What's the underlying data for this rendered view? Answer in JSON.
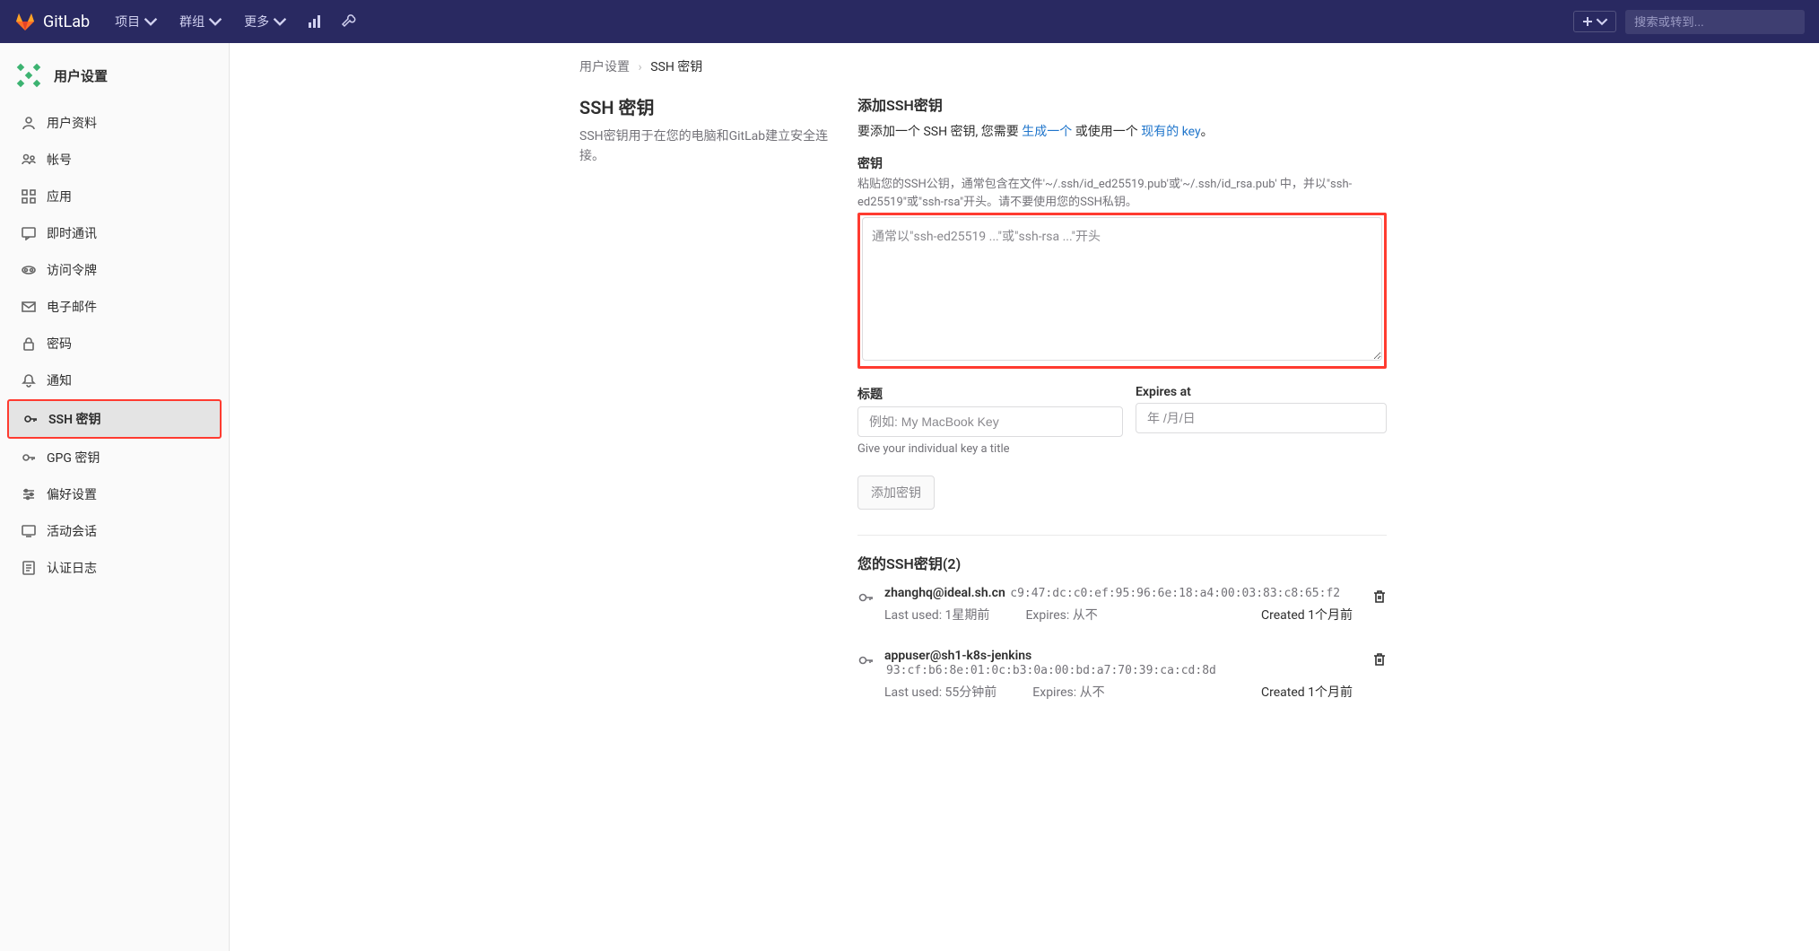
{
  "navbar": {
    "brand": "GitLab",
    "items": [
      {
        "label": "项目"
      },
      {
        "label": "群组"
      },
      {
        "label": "更多"
      }
    ],
    "search_placeholder": "搜索或转到..."
  },
  "sidebar": {
    "title": "用户设置",
    "items": [
      {
        "label": "用户资料",
        "icon": "user"
      },
      {
        "label": "帐号",
        "icon": "account"
      },
      {
        "label": "应用",
        "icon": "apps"
      },
      {
        "label": "即时通讯",
        "icon": "chat"
      },
      {
        "label": "访问令牌",
        "icon": "token"
      },
      {
        "label": "电子邮件",
        "icon": "mail"
      },
      {
        "label": "密码",
        "icon": "lock"
      },
      {
        "label": "通知",
        "icon": "bell"
      },
      {
        "label": "SSH 密钥",
        "icon": "key",
        "active": true
      },
      {
        "label": "GPG 密钥",
        "icon": "key"
      },
      {
        "label": "偏好设置",
        "icon": "pref"
      },
      {
        "label": "活动会话",
        "icon": "session"
      },
      {
        "label": "认证日志",
        "icon": "log"
      }
    ]
  },
  "breadcrumb": {
    "parent": "用户设置",
    "current": "SSH 密钥"
  },
  "left": {
    "title": "SSH 密钥",
    "desc": "SSH密钥用于在您的电脑和GitLab建立安全连接。"
  },
  "right": {
    "add_title": "添加SSH密钥",
    "intro_pre": "要添加一个 SSH 密钥, 您需要 ",
    "intro_link1": "生成一个",
    "intro_mid": " 或使用一个 ",
    "intro_link2": "现有的 key",
    "intro_end": "。",
    "key_label": "密钥",
    "key_help": "粘贴您的SSH公钥，通常包含在文件'~/.ssh/id_ed25519.pub'或'~/.ssh/id_rsa.pub' 中，并以\"ssh-ed25519\"或\"ssh-rsa\"开头。请不要使用您的SSH私钥。",
    "key_placeholder": "通常以\"ssh-ed25519 ...\"或\"ssh-rsa ...\"开头",
    "title_label": "标题",
    "title_placeholder": "例如: My MacBook Key",
    "title_help": "Give your individual key a title",
    "expires_label": "Expires at",
    "expires_placeholder": "年 /月/日",
    "submit": "添加密钥"
  },
  "keys_section": {
    "title": "您的SSH密钥(2)",
    "keys": [
      {
        "name": "zhanghq@ideal.sh.cn",
        "fp": "c9:47:dc:c0:ef:95:96:6e:18:a4:00:03:83:c8:65:f2",
        "last_used": "Last used: 1星期前",
        "expires": "Expires: 从不",
        "created": "Created 1个月前"
      },
      {
        "name": "appuser@sh1-k8s-jenkins",
        "fp": "93:cf:b6:8e:01:0c:b3:0a:00:bd:a7:70:39:ca:cd:8d",
        "last_used": "Last used: 55分钟前",
        "expires": "Expires: 从不",
        "created": "Created 1个月前"
      }
    ]
  }
}
